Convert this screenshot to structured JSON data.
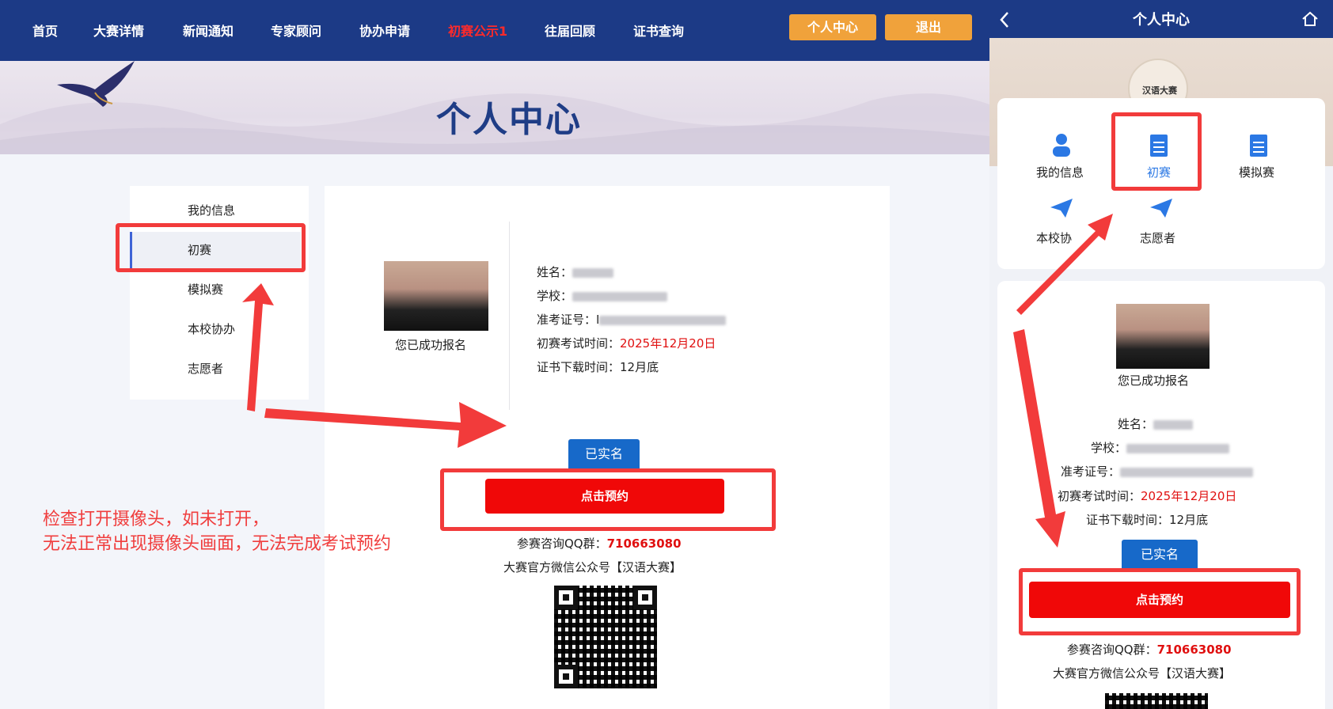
{
  "nav": {
    "items": [
      "首页",
      "大赛详情",
      "新闻通知",
      "专家顾问",
      "协办申请",
      "初赛公示1",
      "往届回顾",
      "证书查询"
    ],
    "active_index": 5,
    "personal_center": "个人中心",
    "logout": "退出"
  },
  "banner": {
    "title": "个人中心"
  },
  "sidebar": {
    "items": [
      "我的信息",
      "初赛",
      "模拟赛",
      "本校协办",
      "志愿者"
    ],
    "active_index": 1
  },
  "profile": {
    "registered": "您已成功报名",
    "name_label": "姓名：",
    "school_label": "学校：",
    "exam_no_label": "准考证号：",
    "exam_no_partial": "I",
    "exam_time_label": "初赛考试时间：",
    "exam_time_value": "2025年12月20日",
    "cert_time_label": "证书下载时间：",
    "cert_time_value": "12月底"
  },
  "actions": {
    "verified": "已实名",
    "book": "点击预约"
  },
  "contact": {
    "qq_label": "参赛咨询QQ群：",
    "qq_value": "710663080",
    "wechat": "大赛官方微信公众号【汉语大赛】"
  },
  "annotation": {
    "line1": "检查打开摄像头，如未打开，",
    "line2": "无法正常出现摄像头画面，无法完成考试预约"
  },
  "mobile": {
    "title": "个人中心",
    "logo_text": "汉语大赛",
    "grid": [
      "我的信息",
      "初赛",
      "模拟赛",
      "本校协办",
      "志愿者"
    ],
    "grid_visible_partial": "本校协",
    "registered": "您已成功报名",
    "name_label": "姓名：",
    "school_label": "学校：",
    "exam_no_label": "准考证号：",
    "exam_time_label": "初赛考试时间：",
    "exam_time_value": "2025年12月20日",
    "cert_time_label": "证书下载时间：",
    "cert_time_value": "12月底",
    "verified": "已实名",
    "book": "点击预约",
    "qq_label": "参赛咨询QQ群：",
    "qq_value": "710663080",
    "wechat": "大赛官方微信公众号【汉语大赛】"
  },
  "colors": {
    "nav_bg": "#1c3a86",
    "accent_orange": "#f0a23b",
    "red": "#f00808",
    "blue_tag": "#1769c9",
    "annotation": "#f23b3b"
  },
  "icons": [
    "swallow-icon",
    "user-icon",
    "document-icon",
    "paper-plane-icon",
    "back-icon",
    "home-icon",
    "qr-code-icon"
  ]
}
